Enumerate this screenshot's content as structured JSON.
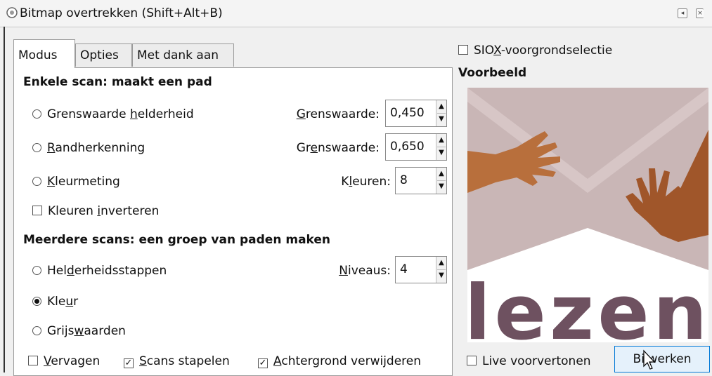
{
  "window": {
    "title": "Bitmap overtrekken (Shift+Alt+B)"
  },
  "tabs": [
    {
      "label": "Modus"
    },
    {
      "label": "Opties"
    },
    {
      "label": "Met dank aan"
    }
  ],
  "single_scan": {
    "header": "Enkele scan: maakt een pad",
    "options": [
      {
        "pre": "Grenswaarde ",
        "u": "h",
        "post": "elderheid",
        "selected": false,
        "param_pre": "",
        "param_u": "G",
        "param_post": "renswaarde:",
        "value": "0,450"
      },
      {
        "pre": "",
        "u": "R",
        "post": "andherkenning",
        "selected": false,
        "param_pre": "Gr",
        "param_u": "e",
        "param_post": "nswaarde:",
        "value": "0,650"
      },
      {
        "pre": "",
        "u": "K",
        "post": "leurmeting",
        "selected": false,
        "param_pre": "K",
        "param_u": "l",
        "param_post": "euren:",
        "value": "8"
      }
    ],
    "invert": {
      "pre": "Kleuren ",
      "u": "i",
      "post": "nverteren",
      "checked": false
    }
  },
  "multi_scan": {
    "header": "Meerdere scans: een groep van paden maken",
    "options": [
      {
        "pre": "Hel",
        "u": "d",
        "post": "erheidsstappen",
        "selected": false,
        "param_pre": "",
        "param_u": "N",
        "param_post": "iveaus:",
        "value": "4"
      },
      {
        "pre": "Kle",
        "u": "u",
        "post": "r",
        "selected": true
      },
      {
        "pre": "Grijs",
        "u": "w",
        "post": "aarden",
        "selected": false
      }
    ],
    "bottom_checks": [
      {
        "pre": "",
        "u": "V",
        "post": "ervagen",
        "checked": false
      },
      {
        "pre": "",
        "u": "S",
        "post": "cans stapelen",
        "checked": true
      },
      {
        "pre": "",
        "u": "A",
        "post": "chtergrond verwijderen",
        "checked": true
      }
    ]
  },
  "siox": {
    "pre": "SIO",
    "u": "X",
    "post": "-voorgrondselectie",
    "checked": false
  },
  "preview": {
    "label": "Voorbeeld",
    "image_text": "lezen",
    "colors": {
      "bg": "#c9b6b6",
      "hand_left": "#b86f3c",
      "hand_right": "#a0562a",
      "text": "#6e5160"
    }
  },
  "live_preview": {
    "label": "Live voorvertonen",
    "checked": false
  },
  "apply_button": {
    "label": "Bijwerken"
  }
}
